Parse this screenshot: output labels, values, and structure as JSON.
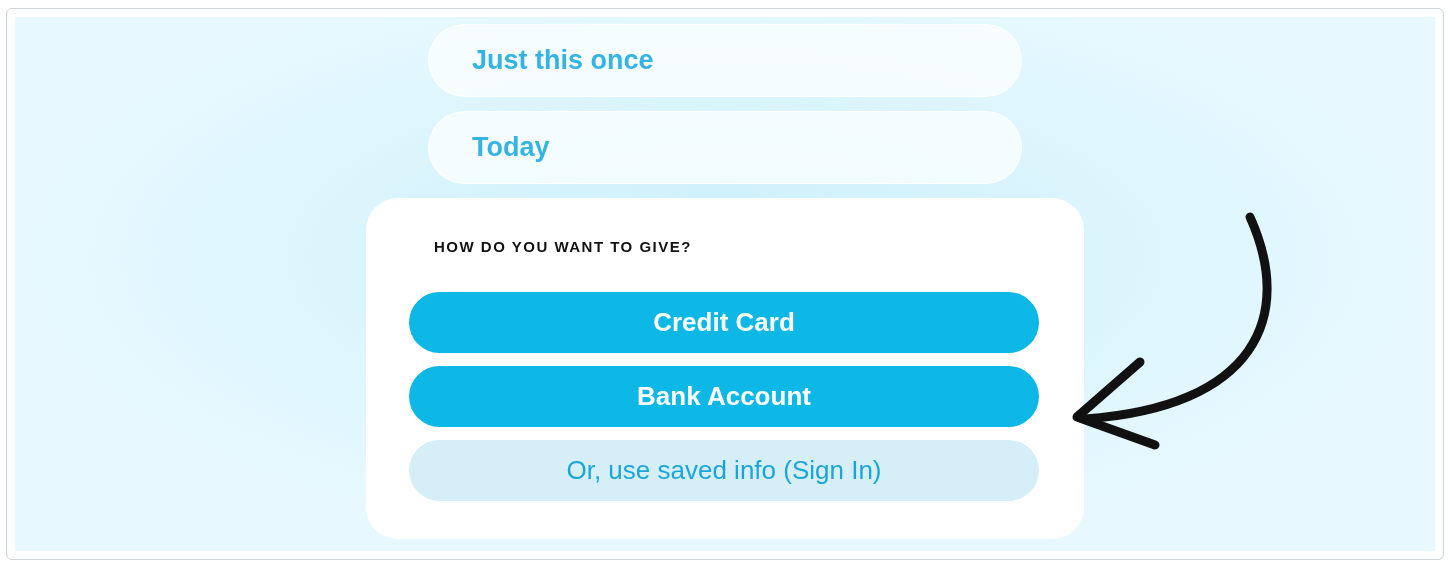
{
  "frequency_options": [
    {
      "label": "Just this once"
    },
    {
      "label": "Today"
    }
  ],
  "payment": {
    "heading": "HOW DO YOU WANT TO GIVE?",
    "buttons": [
      {
        "label": "Credit Card",
        "kind": "primary"
      },
      {
        "label": "Bank Account",
        "kind": "primary"
      },
      {
        "label": "Or, use saved info (Sign In)",
        "kind": "secondary"
      }
    ]
  }
}
